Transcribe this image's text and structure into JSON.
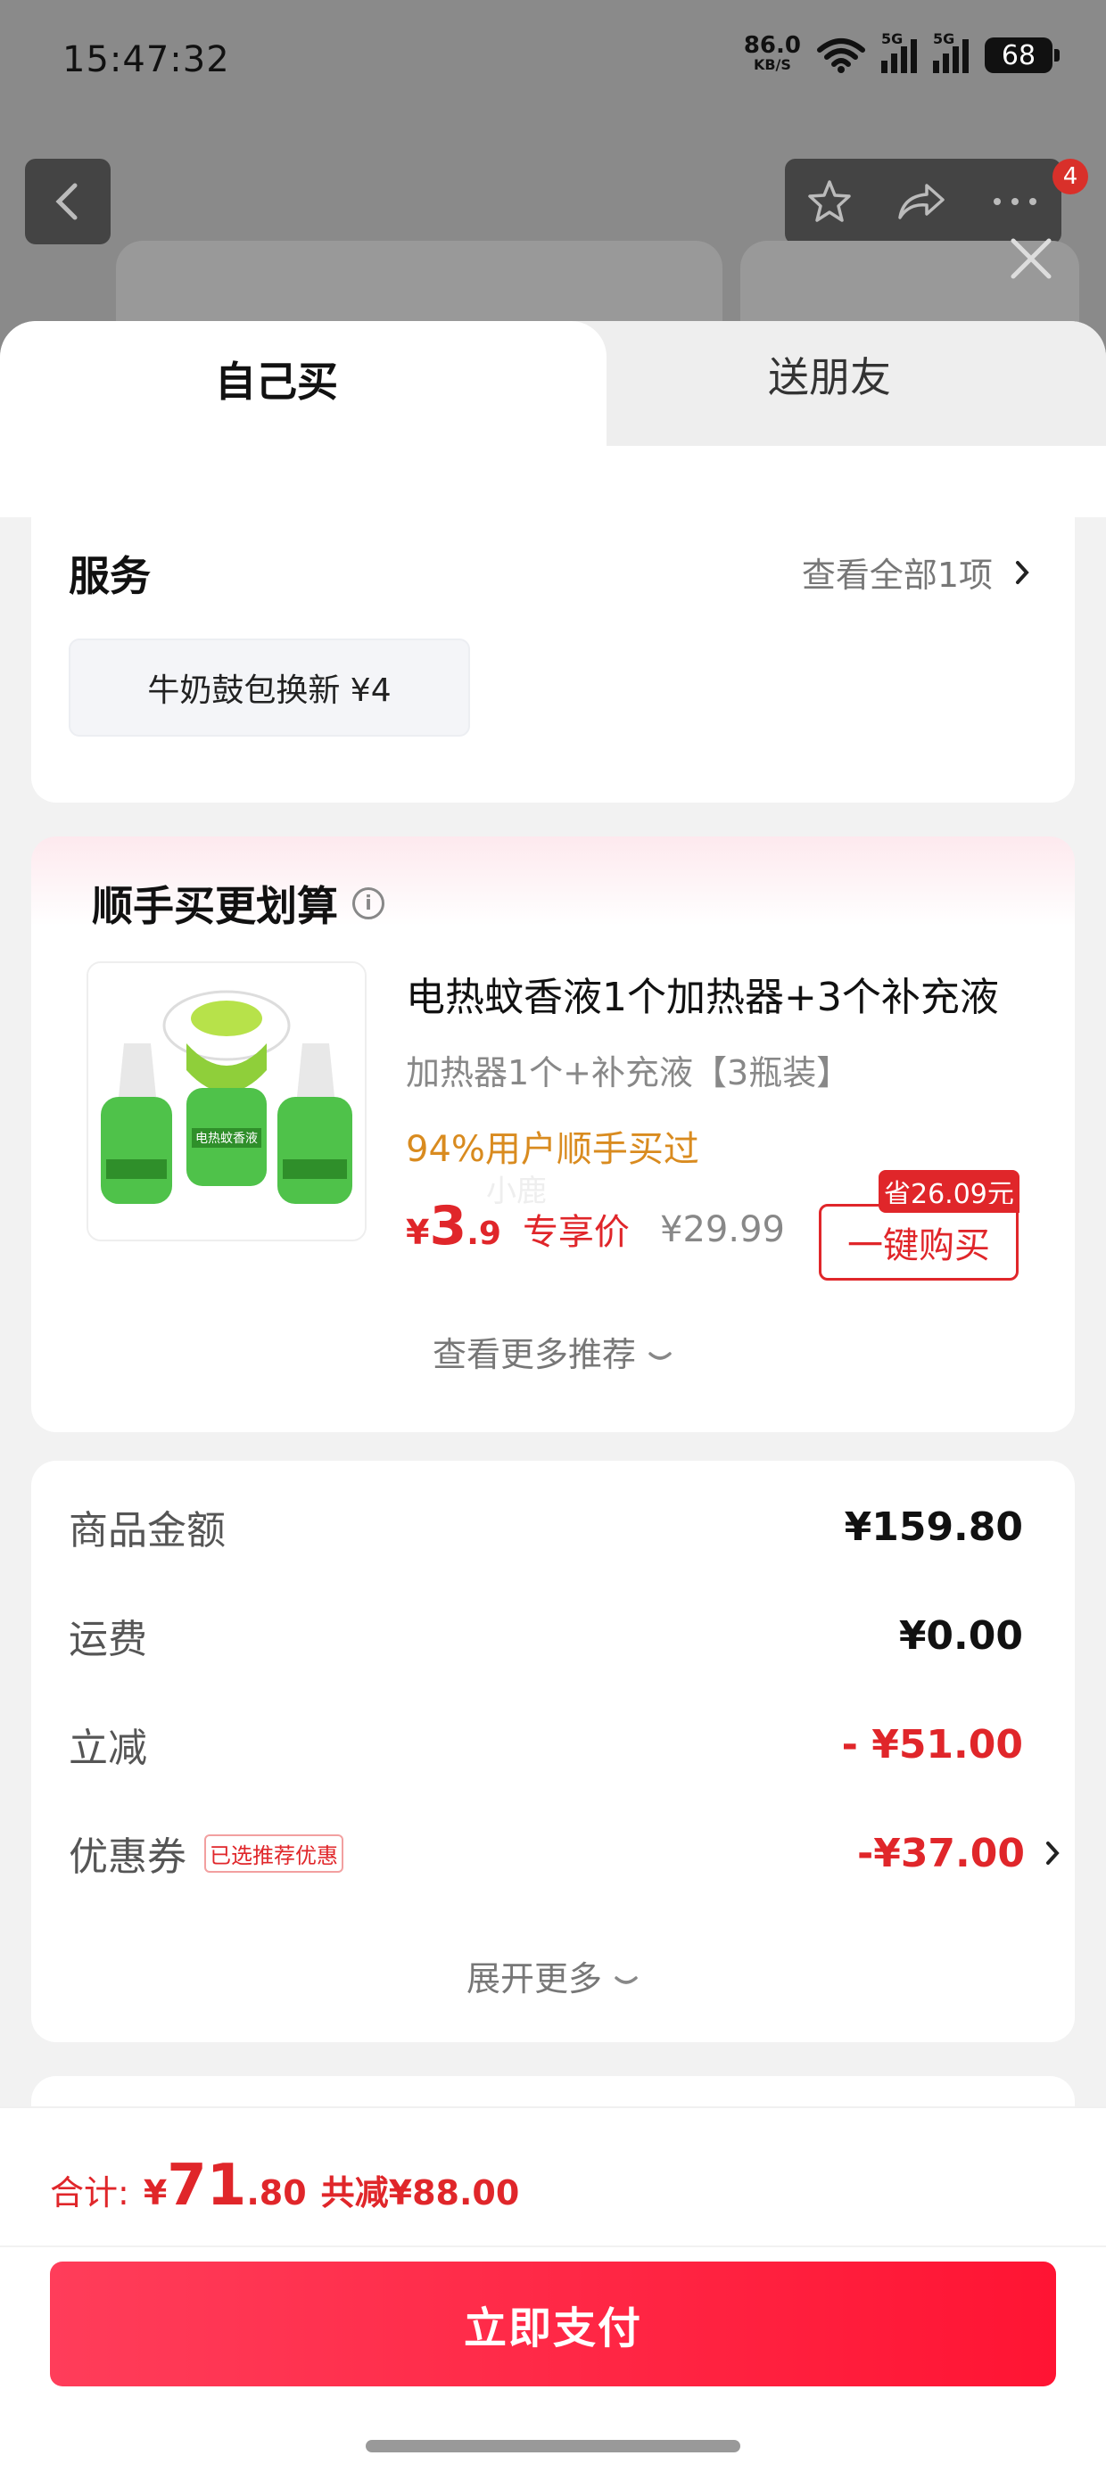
{
  "status_bar": {
    "time": "15:47:32",
    "net_speed": "86.0",
    "net_unit": "KB/S",
    "sim1_label": "5G",
    "sim2_label": "5G",
    "battery": "68"
  },
  "header": {
    "cart_count": "4"
  },
  "tabs": {
    "self_label": "自己买",
    "friend_label": "送朋友"
  },
  "service": {
    "title": "服务",
    "view_all": "查看全部1项",
    "chip": "牛奶鼓包换新  ¥4"
  },
  "recommend": {
    "title": "顺手买更划算",
    "product_name": "电热蚊香液1个加热器+3个补充液",
    "product_spec": "加热器1个+补充液【3瓶装】",
    "hint": "94%用户顺手买过",
    "price_currency": "¥",
    "price_int": "3",
    "price_dec": ".9",
    "price_label": "专享价",
    "original_price": "¥29.99",
    "save_badge": "省26.09元",
    "buy_button": "一键购买",
    "more": "查看更多推荐",
    "watermark": "小鹿",
    "image_label": "电热蚊香液"
  },
  "summary": {
    "rows": [
      {
        "key": "商品金额",
        "value": "¥159.80"
      },
      {
        "key": "运费",
        "value": "¥0.00"
      },
      {
        "key": "立减",
        "value": "- ¥51.00"
      },
      {
        "key": "优惠券",
        "value": "-¥37.00",
        "tag": "已选推荐优惠"
      }
    ],
    "expand": "展开更多"
  },
  "footer": {
    "total_label": "合计:",
    "total_currency": "¥",
    "total_int": "71",
    "total_dec": ".80",
    "total_save": "共减¥88.00",
    "pay_button": "立即支付"
  },
  "colors": {
    "accent_red": "#e0262a",
    "hint_orange": "#d98b1f",
    "pay_gradient_start": "#ff3d5a",
    "pay_gradient_end": "#ff1433"
  }
}
